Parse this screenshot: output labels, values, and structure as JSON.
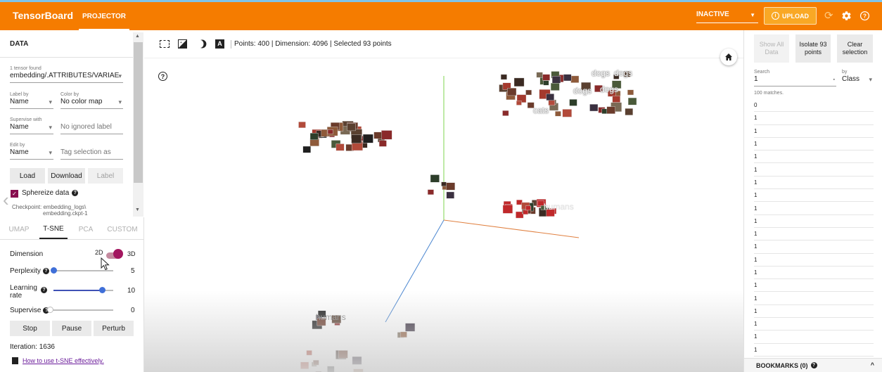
{
  "header": {
    "brand": "TensorBoard",
    "tab": "PROJECTOR",
    "status_select": "INACTIVE",
    "upload_label": "UPLOAD",
    "icons": [
      "refresh-icon",
      "settings-icon",
      "help-icon"
    ]
  },
  "data_panel": {
    "title": "DATA",
    "tensor_found_label": "1 tensor found",
    "tensor_value": "embedding/.ATTRIBUTES/VARIAE",
    "label_by": {
      "label": "Label by",
      "value": "Name"
    },
    "color_by": {
      "label": "Color by",
      "value": "No color map"
    },
    "supervise_with": {
      "label": "Supervise with",
      "value": "Name"
    },
    "ignored_label_placeholder": "No ignored label",
    "edit_by": {
      "label": "Edit by",
      "value": "Name"
    },
    "tag_selection_placeholder": "Tag selection as",
    "buttons": {
      "load": "Load",
      "download": "Download",
      "label": "Label"
    },
    "sphereize": "Sphereize data",
    "checkpoint_line1": "Checkpoint: embedding_logs\\",
    "checkpoint_line2": "embedding.ckpt-1"
  },
  "method_tabs": [
    "UMAP",
    "T-SNE",
    "PCA",
    "CUSTOM"
  ],
  "tsne": {
    "dimension_label": "Dimension",
    "dim_2d": "2D",
    "dim_3d": "3D",
    "perplexity_label": "Perplexity",
    "perplexity_value": "5",
    "learning_rate_label_1": "Learning",
    "learning_rate_label_2": "rate",
    "learning_rate_value": "10",
    "supervise_label": "Supervise",
    "supervise_value": "0",
    "buttons": {
      "stop": "Stop",
      "pause": "Pause",
      "perturb": "Perturb"
    },
    "iteration": "Iteration: 1636",
    "howto_link": "How to use t-SNE effectively."
  },
  "toolbar": {
    "status_text": "Points: 400 | Dimension: 4096 | Selected 93 points"
  },
  "canvas": {
    "help": "?",
    "labels": {
      "dogs": "dogs",
      "cats": "cats",
      "humans": "humans"
    }
  },
  "inspector": {
    "show_all": [
      "Show All",
      "Data"
    ],
    "isolate": [
      "Isolate 93",
      "points"
    ],
    "clear": [
      "Clear",
      "selection"
    ],
    "search_label": "Search",
    "search_value": "1",
    "by_label": "by",
    "by_value": "Class",
    "matches": "100 matches.",
    "list": [
      "0",
      "1",
      "1",
      "1",
      "1",
      "1",
      "1",
      "1",
      "1",
      "1",
      "1",
      "1",
      "1",
      "1",
      "1",
      "1",
      "1",
      "1",
      "1",
      "1"
    ],
    "bookmarks": "BOOKMARKS (0)"
  }
}
